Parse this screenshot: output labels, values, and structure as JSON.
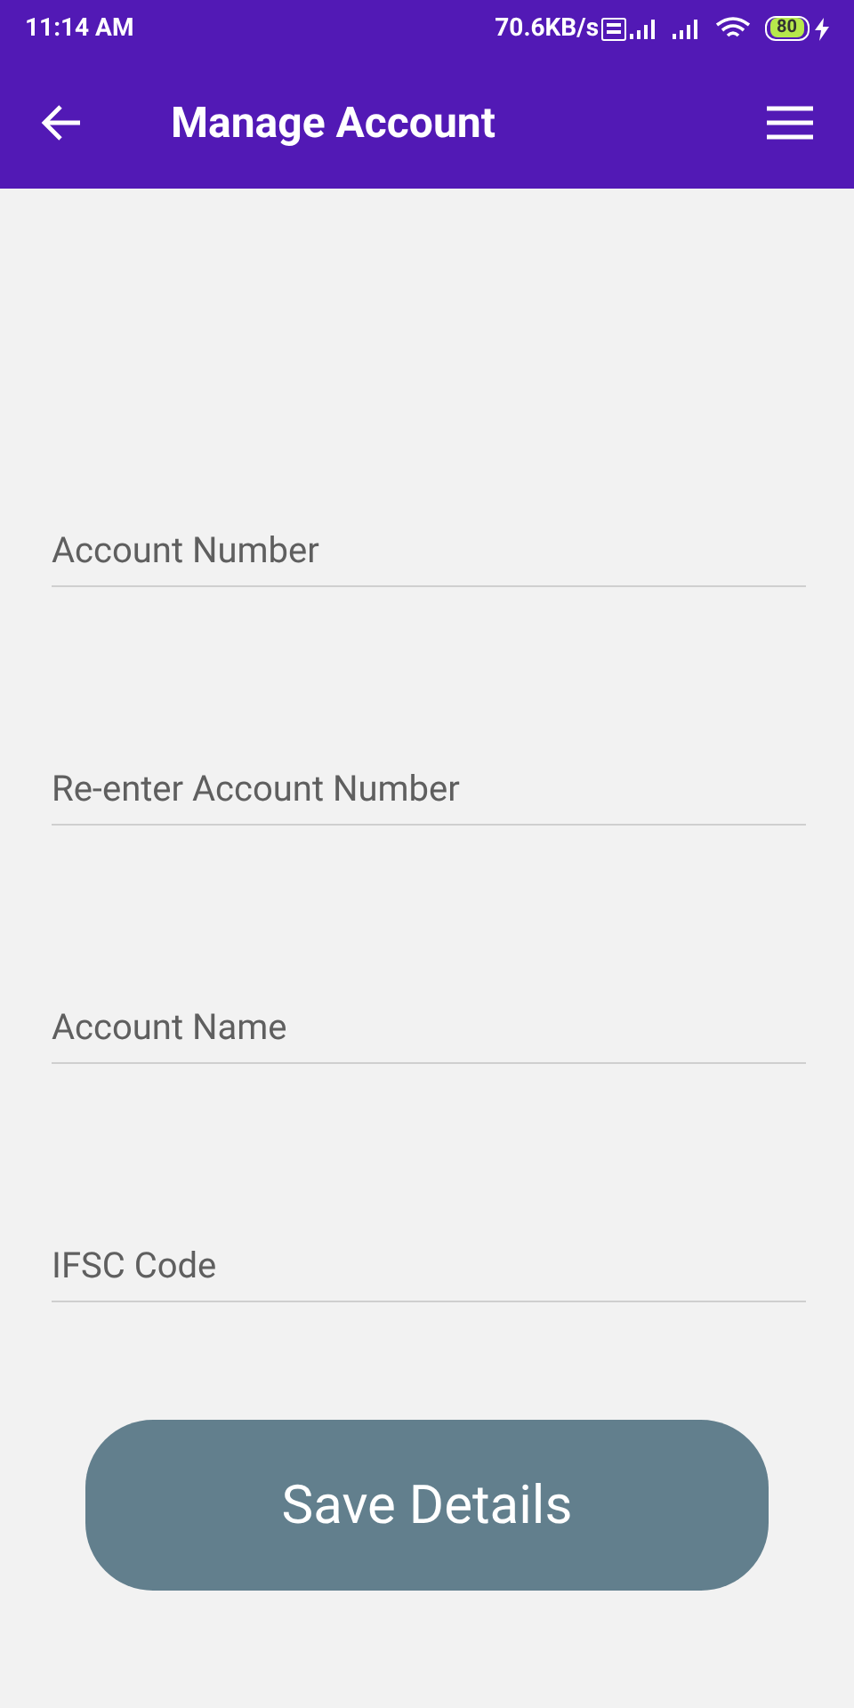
{
  "status_bar": {
    "time": "11:14 AM",
    "speed": "70.6KB/s",
    "battery": "80"
  },
  "app_bar": {
    "title": "Manage Account"
  },
  "fields": [
    {
      "placeholder": "Account Number"
    },
    {
      "placeholder": "Re-enter Account Number"
    },
    {
      "placeholder": "Account Name"
    },
    {
      "placeholder": "IFSC Code"
    }
  ],
  "save_button": {
    "label": "Save Details"
  }
}
